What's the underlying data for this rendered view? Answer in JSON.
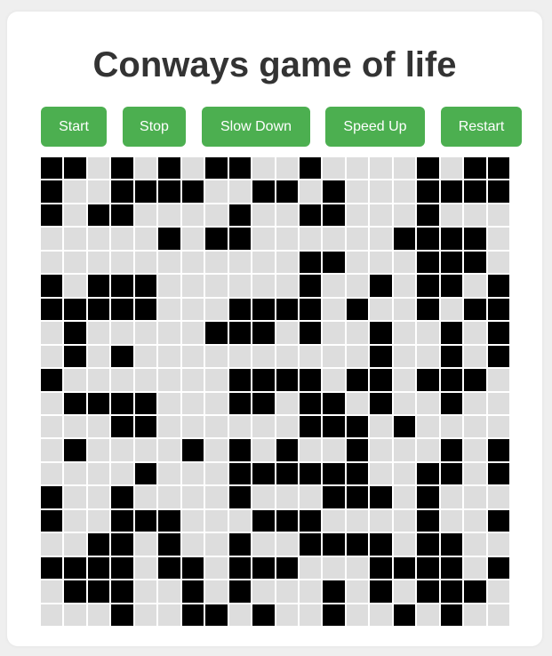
{
  "title": "Conways game of life",
  "buttons": {
    "start": "Start",
    "stop": "Stop",
    "slow_down": "Slow Down",
    "speed_up": "Speed Up",
    "restart": "Restart"
  },
  "colors": {
    "accent": "#4caf50",
    "alive": "#000000",
    "dead": "#dddddd",
    "title_text": "#333333",
    "card": "#ffffff",
    "page_bg": "#efefef"
  },
  "grid": {
    "rows": 20,
    "cols": 20,
    "cells": [
      "11010101100100001011",
      "10011110011010001111",
      "10110000100110001000",
      "00000101100000011110",
      "00000000000110001110",
      "10111000000100101101",
      "11111000111101001011",
      "01000001110100100101",
      "01010000000000100101",
      "10000000111101101110",
      "01111000110110100100",
      "00011000000111010000",
      "01000010101001000101",
      "00001000111111001101",
      "10010000100011101000",
      "10011100011100001001",
      "00110100100111101100",
      "11110110111000111101",
      "01110010100010101110",
      "00010011010010010100"
    ]
  }
}
